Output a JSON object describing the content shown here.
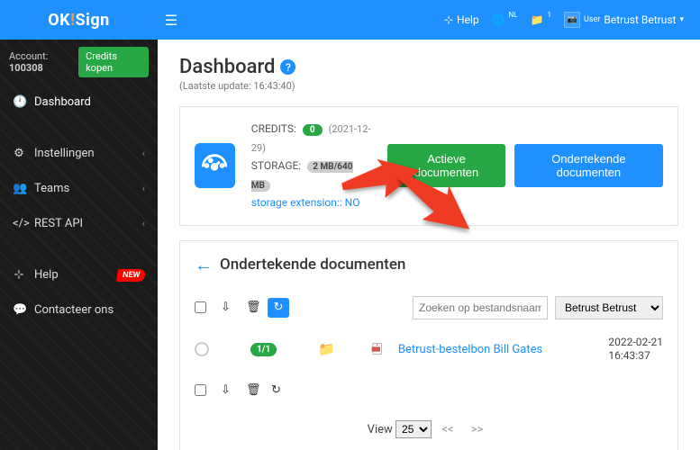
{
  "brand": {
    "part1": "OK",
    "part2": "!",
    "part3": "Sign"
  },
  "topbar": {
    "help": "Help",
    "lang_sup": "NL",
    "user_label": "User",
    "user_name": "Betrust Betrust"
  },
  "account": {
    "prefix": "Account:",
    "number": "100308",
    "credits_btn": "Credits kopen"
  },
  "nav": {
    "dashboard": "Dashboard",
    "settings": "Instellingen",
    "teams": "Teams",
    "restapi": "REST API",
    "help": "Help",
    "new_badge": "NEW",
    "contact": "Contacteer ons"
  },
  "page": {
    "title": "Dashboard",
    "subtitle_prefix": "(Laatste update:",
    "subtitle_time": "16:43:40",
    "subtitle_suffix": ")"
  },
  "stats": {
    "credits_label": "CREDITS:",
    "credits_value": "0",
    "credits_date": "(2021-12-29)",
    "storage_label": "STORAGE:",
    "storage_value": "2 MB/640 MB",
    "ext_link": "storage extension:: NO"
  },
  "actions": {
    "active": "Actieve documenten",
    "signed": "Ondertekende documenten"
  },
  "section": {
    "title": "Ondertekende documenten"
  },
  "filters": {
    "search_placeholder": "Zoeken op bestandsnaam",
    "select_value": "Betrust Betrust"
  },
  "doc": {
    "count": "1/1",
    "name": "Betrust-bestelbon Bill Gates",
    "date": "2022-02-21",
    "time": "16:43:37"
  },
  "pager": {
    "label": "View",
    "size": "25",
    "prev": "<<",
    "next": ">>"
  }
}
